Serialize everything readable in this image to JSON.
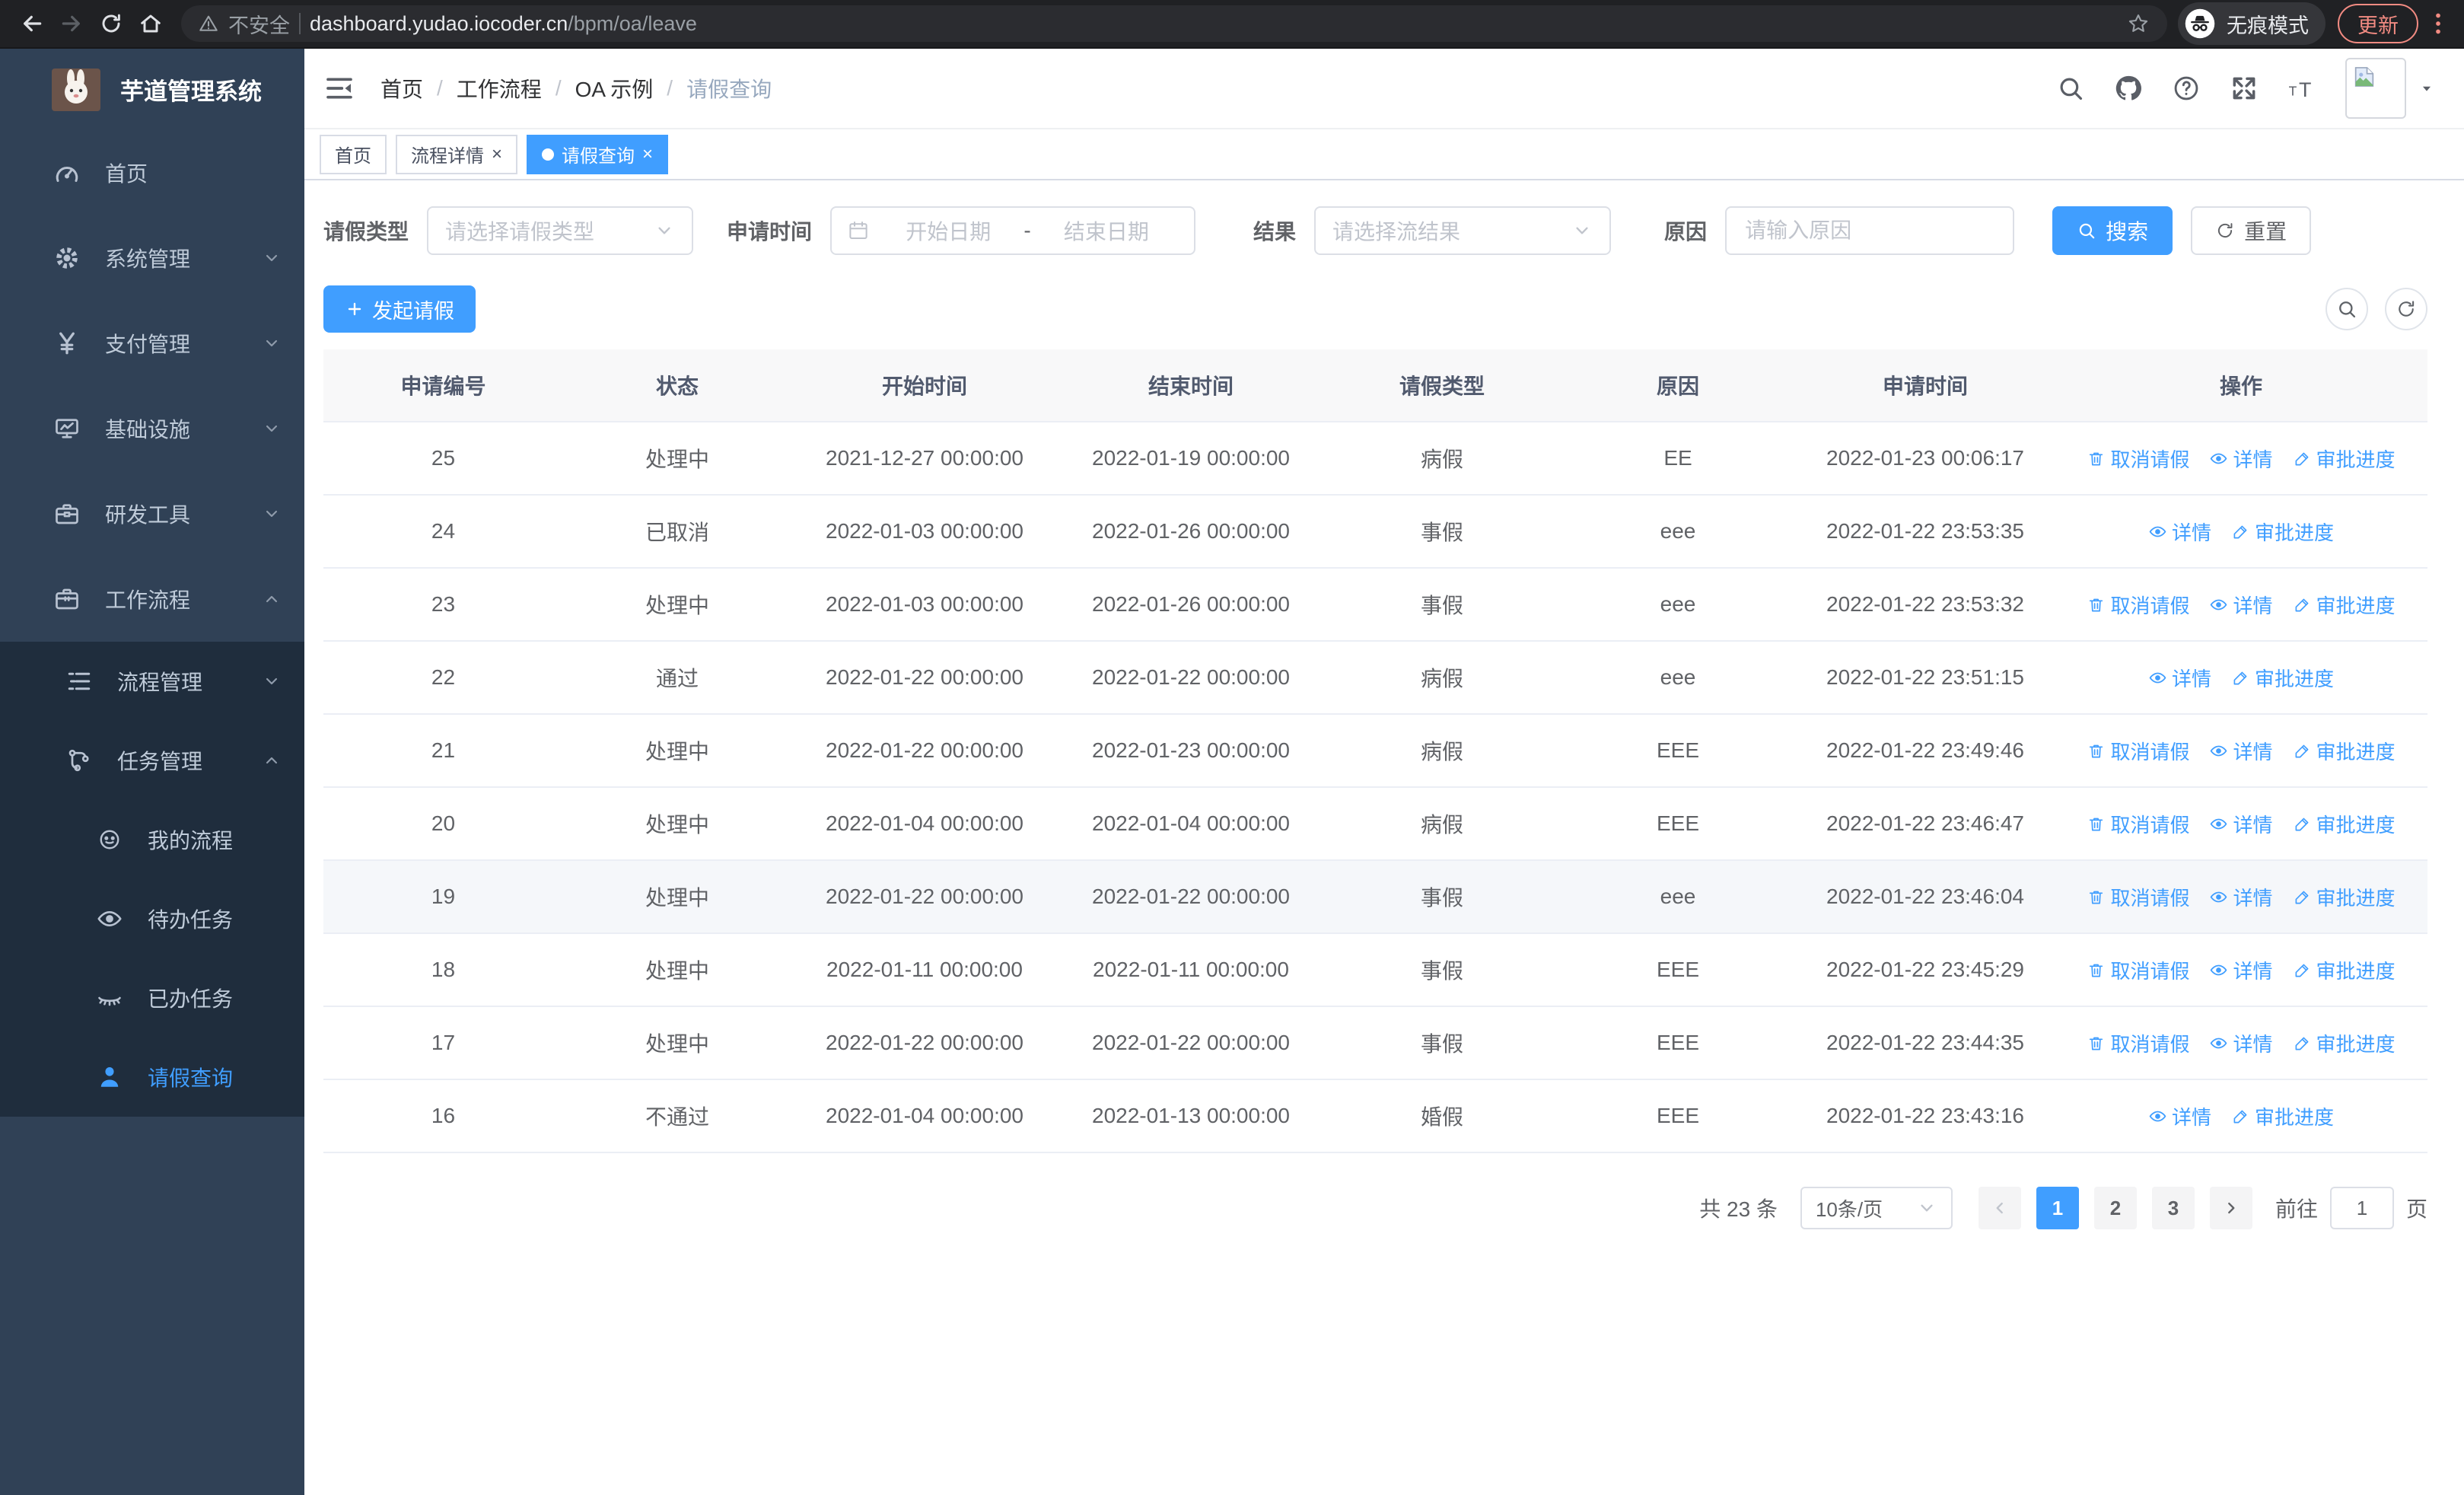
{
  "colors": {
    "accent": "#409eff",
    "sidebar_bg": "#304156",
    "submenu_bg": "#1f2d3d",
    "incognito_accent": "#f28b82"
  },
  "browser": {
    "security_label": "不安全",
    "url_host": "dashboard.yudao.iocoder.cn",
    "url_path": "/bpm/oa/leave",
    "incognito_label": "无痕模式",
    "update_label": "更新"
  },
  "sidebar": {
    "app_title": "芋道管理系统",
    "menu": [
      {
        "label": "首页",
        "icon": "dashboard-icon",
        "chevron": null,
        "active": false
      },
      {
        "label": "系统管理",
        "icon": "gear-icon",
        "chevron": "down",
        "active": false
      },
      {
        "label": "支付管理",
        "icon": "yen-icon",
        "chevron": "down",
        "active": false
      },
      {
        "label": "基础设施",
        "icon": "monitor-icon",
        "chevron": "down",
        "active": false
      },
      {
        "label": "研发工具",
        "icon": "toolbox-icon",
        "chevron": "down",
        "active": false
      },
      {
        "label": "工作流程",
        "icon": "briefcase-icon",
        "chevron": "up",
        "active": false
      }
    ],
    "submenu": [
      {
        "label": "流程管理",
        "icon": "list-icon",
        "chevron": "down",
        "level": 2,
        "active": false
      },
      {
        "label": "任务管理",
        "icon": "flow-icon",
        "chevron": "up",
        "level": 2,
        "active": false
      },
      {
        "label": "我的流程",
        "icon": "robot-icon",
        "chevron": null,
        "level": 3,
        "active": false
      },
      {
        "label": "待办任务",
        "icon": "eye-icon",
        "chevron": null,
        "level": 3,
        "active": false
      },
      {
        "label": "已办任务",
        "icon": "eye-closed-icon",
        "chevron": null,
        "level": 3,
        "active": false
      },
      {
        "label": "请假查询",
        "icon": "user-icon",
        "chevron": null,
        "level": 3,
        "active": true
      }
    ]
  },
  "header": {
    "breadcrumb": [
      "首页",
      "工作流程",
      "OA 示例",
      "请假查询"
    ]
  },
  "tags": [
    {
      "label": "首页",
      "closable": false,
      "active": false
    },
    {
      "label": "流程详情",
      "closable": true,
      "active": false
    },
    {
      "label": "请假查询",
      "closable": true,
      "active": true
    }
  ],
  "filters": {
    "leave_type_label": "请假类型",
    "leave_type_placeholder": "请选择请假类型",
    "apply_time_label": "申请时间",
    "start_date_placeholder": "开始日期",
    "range_separator": "-",
    "end_date_placeholder": "结束日期",
    "result_label": "结果",
    "result_placeholder": "请选择流结果",
    "reason_label": "原因",
    "reason_placeholder": "请输入原因",
    "search_label": "搜索",
    "reset_label": "重置"
  },
  "toolbar": {
    "create_label": "发起请假"
  },
  "table": {
    "columns": [
      "申请编号",
      "状态",
      "开始时间",
      "结束时间",
      "请假类型",
      "原因",
      "申请时间",
      "操作"
    ],
    "action_defs": {
      "cancel": {
        "label": "取消请假",
        "icon": "trash-icon"
      },
      "detail": {
        "label": "详情",
        "icon": "eye-icon"
      },
      "progress": {
        "label": "审批进度",
        "icon": "edit-icon"
      }
    },
    "rows": [
      {
        "id": "25",
        "status": "处理中",
        "start": "2021-12-27 00:00:00",
        "end": "2022-01-19 00:00:00",
        "type": "病假",
        "reason": "EE",
        "applyTime": "2022-01-23 00:06:17",
        "actions": [
          "cancel",
          "detail",
          "progress"
        ],
        "highlighted": false
      },
      {
        "id": "24",
        "status": "已取消",
        "start": "2022-01-03 00:00:00",
        "end": "2022-01-26 00:00:00",
        "type": "事假",
        "reason": "eee",
        "applyTime": "2022-01-22 23:53:35",
        "actions": [
          "detail",
          "progress"
        ],
        "highlighted": false
      },
      {
        "id": "23",
        "status": "处理中",
        "start": "2022-01-03 00:00:00",
        "end": "2022-01-26 00:00:00",
        "type": "事假",
        "reason": "eee",
        "applyTime": "2022-01-22 23:53:32",
        "actions": [
          "cancel",
          "detail",
          "progress"
        ],
        "highlighted": false
      },
      {
        "id": "22",
        "status": "通过",
        "start": "2022-01-22 00:00:00",
        "end": "2022-01-22 00:00:00",
        "type": "病假",
        "reason": "eee",
        "applyTime": "2022-01-22 23:51:15",
        "actions": [
          "detail",
          "progress"
        ],
        "highlighted": false
      },
      {
        "id": "21",
        "status": "处理中",
        "start": "2022-01-22 00:00:00",
        "end": "2022-01-23 00:00:00",
        "type": "病假",
        "reason": "EEE",
        "applyTime": "2022-01-22 23:49:46",
        "actions": [
          "cancel",
          "detail",
          "progress"
        ],
        "highlighted": false
      },
      {
        "id": "20",
        "status": "处理中",
        "start": "2022-01-04 00:00:00",
        "end": "2022-01-04 00:00:00",
        "type": "病假",
        "reason": "EEE",
        "applyTime": "2022-01-22 23:46:47",
        "actions": [
          "cancel",
          "detail",
          "progress"
        ],
        "highlighted": false
      },
      {
        "id": "19",
        "status": "处理中",
        "start": "2022-01-22 00:00:00",
        "end": "2022-01-22 00:00:00",
        "type": "事假",
        "reason": "eee",
        "applyTime": "2022-01-22 23:46:04",
        "actions": [
          "cancel",
          "detail",
          "progress"
        ],
        "highlighted": true
      },
      {
        "id": "18",
        "status": "处理中",
        "start": "2022-01-11 00:00:00",
        "end": "2022-01-11 00:00:00",
        "type": "事假",
        "reason": "EEE",
        "applyTime": "2022-01-22 23:45:29",
        "actions": [
          "cancel",
          "detail",
          "progress"
        ],
        "highlighted": false
      },
      {
        "id": "17",
        "status": "处理中",
        "start": "2022-01-22 00:00:00",
        "end": "2022-01-22 00:00:00",
        "type": "事假",
        "reason": "EEE",
        "applyTime": "2022-01-22 23:44:35",
        "actions": [
          "cancel",
          "detail",
          "progress"
        ],
        "highlighted": false
      },
      {
        "id": "16",
        "status": "不通过",
        "start": "2022-01-04 00:00:00",
        "end": "2022-01-13 00:00:00",
        "type": "婚假",
        "reason": "EEE",
        "applyTime": "2022-01-22 23:43:16",
        "actions": [
          "detail",
          "progress"
        ],
        "highlighted": false
      }
    ]
  },
  "pagination": {
    "total_label": "共 23 条",
    "page_size_value": "10条/页",
    "pages": [
      "1",
      "2",
      "3"
    ],
    "active_page": "1",
    "goto_label": "前往",
    "goto_value": "1",
    "goto_suffix": "页"
  }
}
